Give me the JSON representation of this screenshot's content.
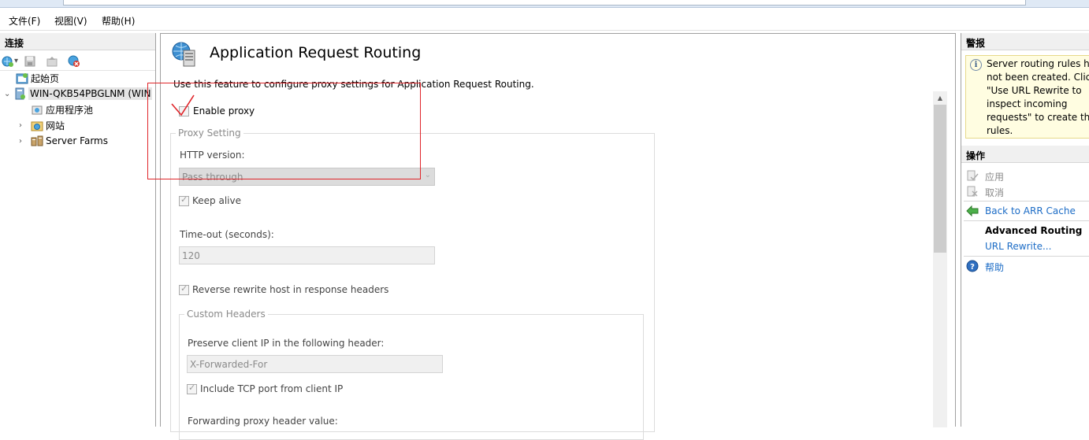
{
  "menu": {
    "file": "文件(F)",
    "view": "视图(V)",
    "help": "帮助(H)"
  },
  "connections": {
    "header": "连接",
    "toolbar_icons": [
      "connect-icon",
      "save-icon",
      "up-icon",
      "disconnect-icon"
    ],
    "tree": [
      {
        "label": "起始页",
        "icon": "start-page-icon"
      },
      {
        "label": "WIN-QKB54PBGLNM (WIN",
        "icon": "server-icon"
      },
      {
        "label": "应用程序池",
        "icon": "app-pool-icon"
      },
      {
        "label": "网站",
        "icon": "sites-icon"
      },
      {
        "label": "Server Farms",
        "icon": "server-farms-icon"
      }
    ]
  },
  "main": {
    "title": "Application Request Routing",
    "description": "Use this feature to configure proxy settings for Application Request Routing.",
    "enable_proxy": {
      "label": "Enable proxy",
      "checked": false
    },
    "proxy_setting": {
      "group_title": "Proxy Setting",
      "http_version_label": "HTTP version:",
      "http_version_value": "Pass through",
      "keep_alive": {
        "label": "Keep alive",
        "checked": true
      },
      "timeout_label": "Time-out (seconds):",
      "timeout_value": "120",
      "reverse_rewrite": {
        "label": "Reverse rewrite host in response headers",
        "checked": true
      },
      "custom_headers": {
        "group_title": "Custom Headers",
        "preserve_label": "Preserve client IP in the following header:",
        "preserve_value": "X-Forwarded-For",
        "include_tcp": {
          "label": "Include TCP port from client IP",
          "checked": true
        },
        "forwarding_label": "Forwarding proxy header value:"
      }
    }
  },
  "alerts": {
    "header": "警报",
    "message_lines": [
      "Server routing rules ha",
      "not been created. Click",
      "\"Use URL Rewrite to",
      "inspect incoming",
      "requests\" to create the",
      "rules."
    ]
  },
  "actions": {
    "header": "操作",
    "apply": "应用",
    "cancel": "取消",
    "back": "Back to ARR Cache",
    "advanced_routing": "Advanced Routing",
    "url_rewrite": "URL Rewrite...",
    "help": "帮助"
  },
  "colors": {
    "link": "#1c6cc6",
    "annotation_red": "#e0252a",
    "alert_bg": "#fffde1"
  }
}
